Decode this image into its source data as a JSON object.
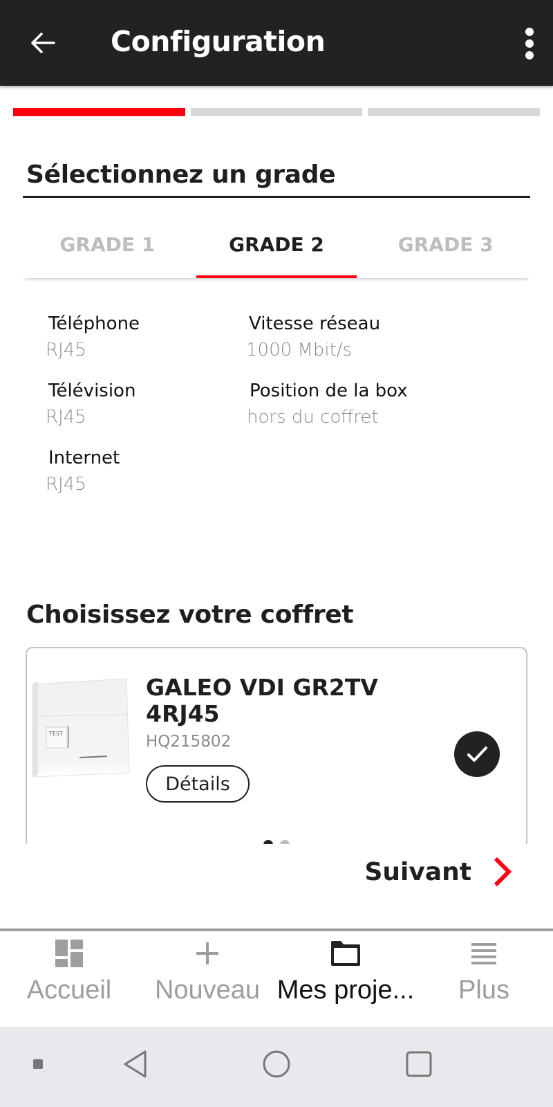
{
  "appbar": {
    "title": "Configuration",
    "back_icon": "arrow-left-icon",
    "more_icon": "more-vert-icon"
  },
  "stepper": {
    "total_steps": 3,
    "current_step": 1,
    "active_color": "#ff000f",
    "inactive_color": "#d8d8d8"
  },
  "grade_section": {
    "title": "Sélectionnez un grade",
    "tabs": [
      {
        "label": "GRADE 1",
        "selected": false
      },
      {
        "label": "GRADE 2",
        "selected": true
      },
      {
        "label": "GRADE 3",
        "selected": false
      }
    ],
    "specs": [
      {
        "label": "Téléphone",
        "value": "RJ45"
      },
      {
        "label": "Vitesse réseau",
        "value": "1000 Mbit/s"
      },
      {
        "label": "Télévision",
        "value": "RJ45"
      },
      {
        "label": "Position de la box",
        "value": "hors du coffret"
      },
      {
        "label": "Internet",
        "value": "RJ45"
      }
    ]
  },
  "coffret_section": {
    "title": "Choisissez votre coffret",
    "product": {
      "name": "GALEO VDI GR2TV 4RJ45",
      "reference": "HQ215802",
      "details_label": "Détails",
      "image_label": "TEST",
      "selected": true
    },
    "carousel": {
      "count": 2,
      "active_index": 0
    }
  },
  "next": {
    "label": "Suivant",
    "icon": "chevron-right-icon",
    "accent": "#ff000f"
  },
  "bottom_nav": {
    "items": [
      {
        "label": "Accueil",
        "icon": "dashboard-icon",
        "active": false
      },
      {
        "label": "Nouveau",
        "icon": "plus-icon",
        "active": false
      },
      {
        "label": "Mes proje...",
        "icon": "folder-icon",
        "active": true
      },
      {
        "label": "Plus",
        "icon": "menu-icon",
        "active": false
      }
    ]
  },
  "system_nav": {
    "buttons": [
      "menu-dot-icon",
      "back-triangle-icon",
      "home-circle-icon",
      "recents-square-icon"
    ]
  }
}
